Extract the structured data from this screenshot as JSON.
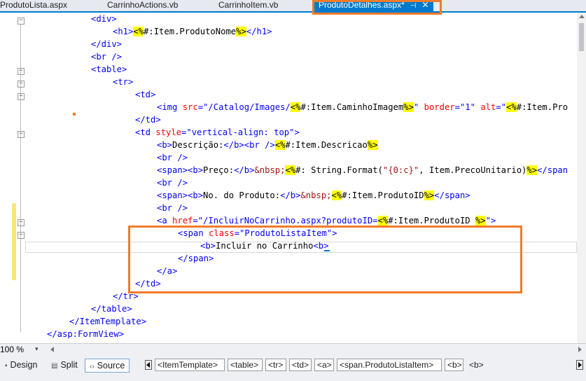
{
  "tabs": [
    {
      "label": "ProdutoLista.aspx"
    },
    {
      "label": "CarrinhoActions.vb"
    },
    {
      "label": "CarrinhoItem.vb"
    },
    {
      "label": "ProdutoDetalhes.aspx*",
      "active": true,
      "pin": "⊣",
      "close": "✕"
    }
  ],
  "code": {
    "l1": "<div>",
    "l2a": "<h1>",
    "l2b": "<%",
    "l2c": "#:Item.ProdutoNome",
    "l2d": "%>",
    "l2e": "</h1>",
    "l3": "</div>",
    "l4": "<br />",
    "l5": "<table>",
    "l6": "<tr>",
    "l7": "<td>",
    "l8a": "<img",
    "l8b": " src",
    "l8c": "=\"/Catalog/Images/",
    "l8d": "<%",
    "l8e": "#:Item.CaminhoImagem",
    "l8f": "%>",
    "l8g": "\"",
    "l8h": " border",
    "l8i": "=\"1\"",
    "l8j": " alt",
    "l8k": "=\"",
    "l8l": "<%",
    "l8m": "#:Item.Pro",
    "l9": "</td>",
    "l10a": "<td",
    "l10b": " style",
    "l10c": "=\"vertical-align: top\">",
    "l11a": "<b>",
    "l11b": "Descrição:",
    "l11c": "</b><br />",
    "l11d": "<%",
    "l11e": "#:Item.Descricao",
    "l11f": "%>",
    "l12": "<br />",
    "l13a": "<span><b>",
    "l13b": "Preço:",
    "l13c": "</b>",
    "l13d": "&nbsp;",
    "l13e": "<%",
    "l13f": "#: String.Format(",
    "l13g": "\"{0:c}\"",
    "l13h": ", Item.PrecoUnitario)",
    "l13i": "%>",
    "l13j": "</span",
    "l14": "<br />",
    "l15a": "<span><b>",
    "l15b": "No. do Produto:",
    "l15c": "</b>",
    "l15d": "&nbsp;",
    "l15e": "<%",
    "l15f": "#:Item.ProdutoID",
    "l15g": "%>",
    "l15h": "</span>",
    "l16": "<br />",
    "l17a": "<a",
    "l17b": " href",
    "l17c": "=\"/IncluirNoCarrinho.aspx?produtoID=",
    "l17d": "<%",
    "l17e": "#:Item.ProdutoID ",
    "l17f": "%>",
    "l17g": "\">",
    "l18a": "<span",
    "l18b": " class",
    "l18c": "=\"ProdutoListaItem\">",
    "l19a": "<b>",
    "l19b": "Incluir no Carrinho",
    "l19c": "<b>",
    "l20": "</span>",
    "l21": "</a>",
    "l22": "</td>",
    "l23": "</tr>",
    "l24": "</table>",
    "l25": "</ItemTemplate>",
    "l26": "</asp:FormView>"
  },
  "status": {
    "zoom": "100 %",
    "zoom_arrow": "▾"
  },
  "views": {
    "design": "Design",
    "split": "Split",
    "source": "Source",
    "design_icon": "▪",
    "split_icon": "▤",
    "source_icon": "‹›"
  },
  "breadcrumb": [
    "<ItemTemplate>",
    "<table>",
    "<tr>",
    "<td>",
    "<a>",
    "<span.ProdutoListaItem>",
    "<b>",
    "<b>"
  ],
  "colors": {
    "accent": "#007acc",
    "highlight": "#f07b2c",
    "delimiter_bg": "#ffff00"
  }
}
